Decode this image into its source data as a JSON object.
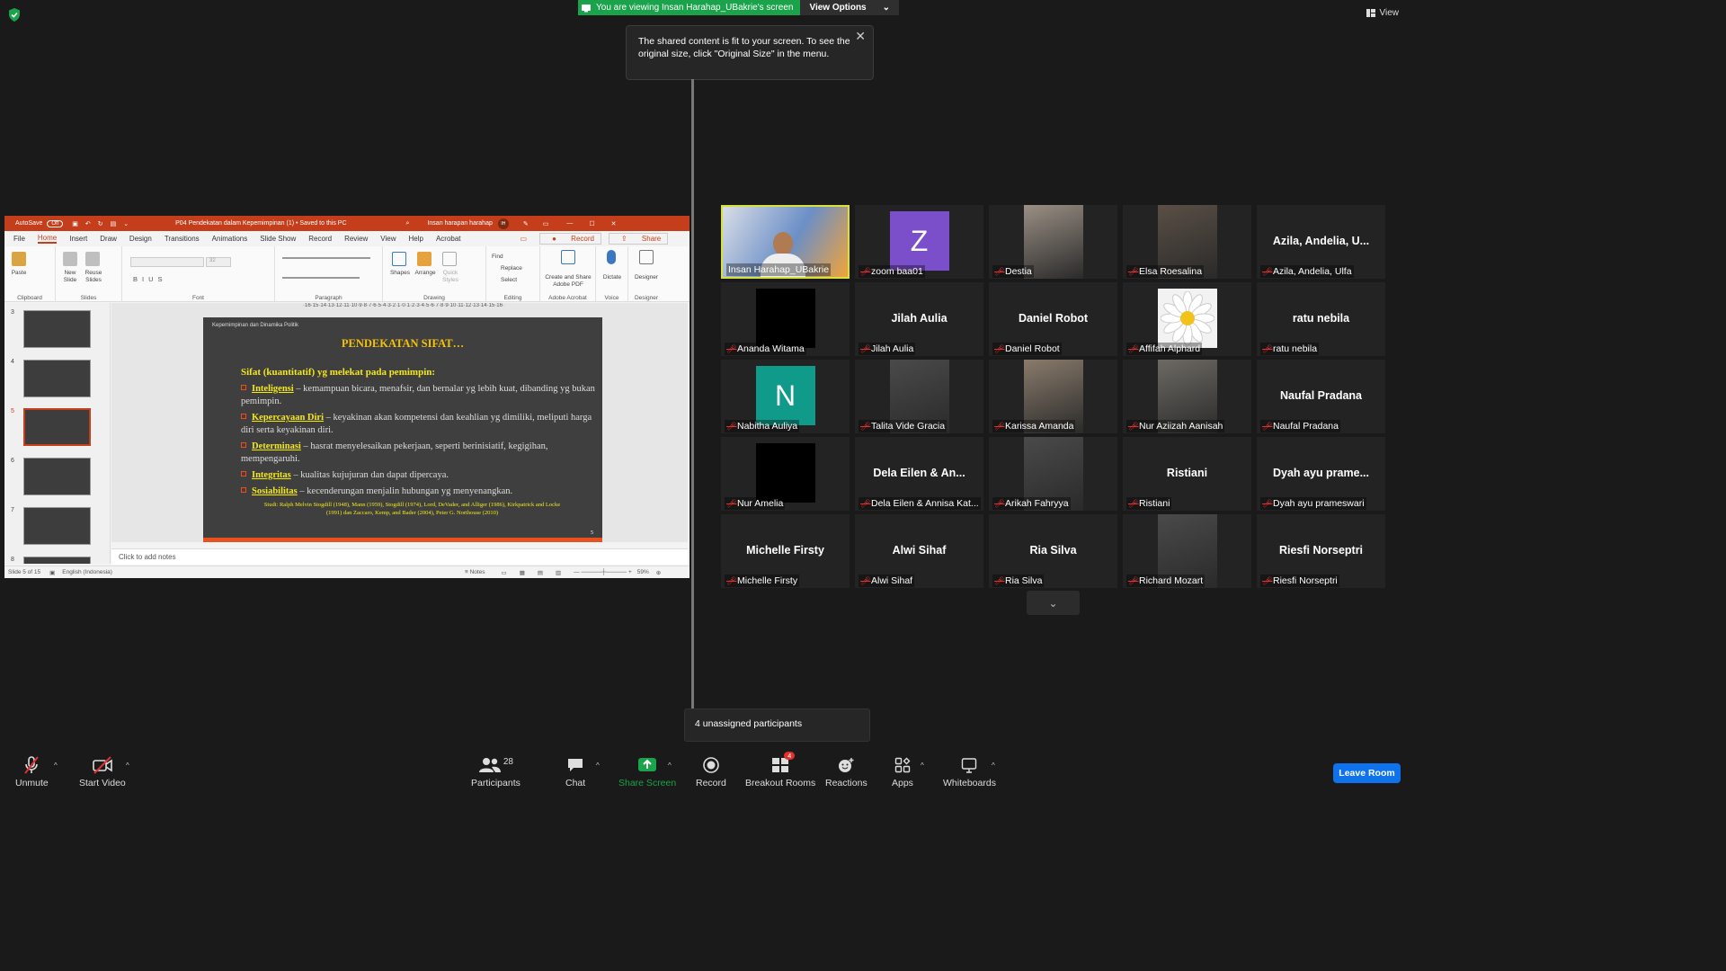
{
  "banner": {
    "viewing": "You are viewing Insan Harahap_UBakrie's screen",
    "options": "View Options"
  },
  "view_button": "View",
  "tooltip": {
    "text": "The shared content is fit to your screen. To see the original size, click \"Original Size\" in the menu."
  },
  "ppt": {
    "autosave": "AutoSave",
    "autosave_state": "Off",
    "doc_title": "P04 Pendekatan dalam Kepemimpinan (1) • Saved to this PC",
    "user": "Insan harapan harahap",
    "user_initials": "IH",
    "tabs": [
      "File",
      "Home",
      "Insert",
      "Draw",
      "Design",
      "Transitions",
      "Animations",
      "Slide Show",
      "Record",
      "Review",
      "View",
      "Help",
      "Acrobat"
    ],
    "record_btn": "Record",
    "share_btn": "Share",
    "ribbon": {
      "paste": "Paste",
      "new_slide": "New Slide",
      "reuse_slides": "Reuse Slides",
      "font_size": "32",
      "shapes": "Shapes",
      "arrange": "Arrange",
      "quick_styles": "Quick Styles",
      "find": "Find",
      "replace": "Replace",
      "select": "Select",
      "create_share": "Create and Share Adobe PDF",
      "dictate": "Dictate",
      "designer": "Designer",
      "groups": [
        "Clipboard",
        "Slides",
        "Font",
        "Paragraph",
        "Drawing",
        "Editing",
        "Adobe Acrobat",
        "Voice",
        "Designer"
      ]
    },
    "ruler": "·16·15·14·13·12·11·10·9·8·7·6·5·4·3·2·1·0·1·2·3·4·5·6·7·8·9·10·11·12·13·14·15·16·",
    "thumb_numbers": [
      "3",
      "4",
      "5",
      "6",
      "7",
      "8"
    ],
    "slide": {
      "header": "Kepemimpinan dan Dinamika Politik",
      "title": "PENDEKATAN  SIFAT…",
      "subtitle": "Sifat  (kuantitatif) yg melekat pada pemimpin:",
      "items": [
        {
          "kw": "Inteligensi",
          "text": " – kemampuan bicara, menafsir, dan bernalar  yg lebih kuat, dibanding yg bukan pemimpin."
        },
        {
          "kw": "Kepercayaan Diri",
          "text": " – keyakinan akan kompetensi dan keahlian yg dimiliki, meliputi harga diri serta keyakinan diri."
        },
        {
          "kw": "Determinasi",
          "text": " – hasrat menyelesaikan pekerjaan, seperti berinisiatif, kegigihan, mempengaruhi."
        },
        {
          "kw": "Integritas",
          "text": " – kualitas kujujuran dan dapat dipercaya."
        },
        {
          "kw": "Sosiabilitas",
          "text": " – kecenderungan menjalin hubungan yg menyenangkan."
        }
      ],
      "citation": "Studi: Ralph Melvin Stogdill (1948), Mann (1959), Stogdill (1974), Lord, DeVader, and Alliger (1986), Kirkpatrick and Locke (1991) dan Zaccaro, Kemp, and Bader (2004), Peter G. Northouse (2010)",
      "page": "5"
    },
    "notes": "Click to add notes",
    "status": {
      "slide": "Slide 5 of 15",
      "language": "English (Indonesia)",
      "notes": "Notes",
      "zoom": "59%"
    }
  },
  "participants": [
    {
      "name": "Insan Harahap_UBakrie",
      "display": "",
      "type": "video-host",
      "active": true,
      "muted": false
    },
    {
      "name": "zoom baa01",
      "display": "Z",
      "type": "avatar",
      "color": "#7b4fc9",
      "muted": true
    },
    {
      "name": "Destia",
      "display": "",
      "type": "photo",
      "muted": true
    },
    {
      "name": "Elsa Roesalina",
      "display": "",
      "type": "photo",
      "muted": true
    },
    {
      "name": "Azila, Andelia, Ulfa",
      "display": "Azila, Andelia, U...",
      "type": "name",
      "muted": true
    },
    {
      "name": "Ananda Witama",
      "display": "",
      "type": "black",
      "muted": true
    },
    {
      "name": "Jilah Aulia",
      "display": "Jilah Aulia",
      "type": "name",
      "muted": true
    },
    {
      "name": "Daniel Robot",
      "display": "Daniel Robot",
      "type": "name",
      "muted": true
    },
    {
      "name": "Affifah Alphard",
      "display": "",
      "type": "flower",
      "muted": true
    },
    {
      "name": "ratu nebila",
      "display": "ratu nebila",
      "type": "name",
      "muted": true
    },
    {
      "name": "Nabitha Auliya",
      "display": "N",
      "type": "avatar",
      "color": "#0f9a8a",
      "muted": true
    },
    {
      "name": "Talita Vide Gracia",
      "display": "",
      "type": "photo",
      "muted": true
    },
    {
      "name": "Karissa Amanda",
      "display": "",
      "type": "photo",
      "muted": true
    },
    {
      "name": "Nur Aziizah Aanisah",
      "display": "",
      "type": "photo",
      "muted": true
    },
    {
      "name": "Naufal Pradana",
      "display": "Naufal Pradana",
      "type": "name",
      "muted": true
    },
    {
      "name": "Nur Amelia",
      "display": "",
      "type": "black",
      "muted": true
    },
    {
      "name": "Dela Eilen & Annisa Kat...",
      "display": "Dela Eilen & An...",
      "type": "name",
      "muted": true
    },
    {
      "name": "Arikah Fahryya",
      "display": "",
      "type": "photo",
      "muted": true
    },
    {
      "name": "Ristiani",
      "display": "Ristiani",
      "type": "name",
      "muted": true
    },
    {
      "name": "Dyah ayu prameswari",
      "display": "Dyah ayu prame...",
      "type": "name",
      "muted": true
    },
    {
      "name": "Michelle Firsty",
      "display": "Michelle Firsty",
      "type": "name",
      "muted": true
    },
    {
      "name": "Alwi Sihaf",
      "display": "Alwi Sihaf",
      "type": "name",
      "muted": true
    },
    {
      "name": "Ria Silva",
      "display": "Ria Silva",
      "type": "name",
      "muted": true
    },
    {
      "name": "Richard Mozart",
      "display": "",
      "type": "photo",
      "muted": true
    },
    {
      "name": "Riesfi Norseptri",
      "display": "Riesfi Norseptri",
      "type": "name",
      "muted": true
    }
  ],
  "unassigned": "4 unassigned participants",
  "toolbar": {
    "unmute": "Unmute",
    "start_video": "Start Video",
    "participants": "Participants",
    "participants_count": "28",
    "chat": "Chat",
    "share_screen": "Share Screen",
    "record": "Record",
    "breakout_rooms": "Breakout Rooms",
    "breakout_badge": "4",
    "reactions": "Reactions",
    "apps": "Apps",
    "whiteboards": "Whiteboards",
    "leave": "Leave Room"
  },
  "colors": {
    "zoom_blue": "#0e72ed",
    "share_green": "#1aa34a",
    "ppt_red": "#c43e1c",
    "active_border": "#d6e23a",
    "slide_yellow": "#f4e81a",
    "muted_red": "#e03030"
  }
}
